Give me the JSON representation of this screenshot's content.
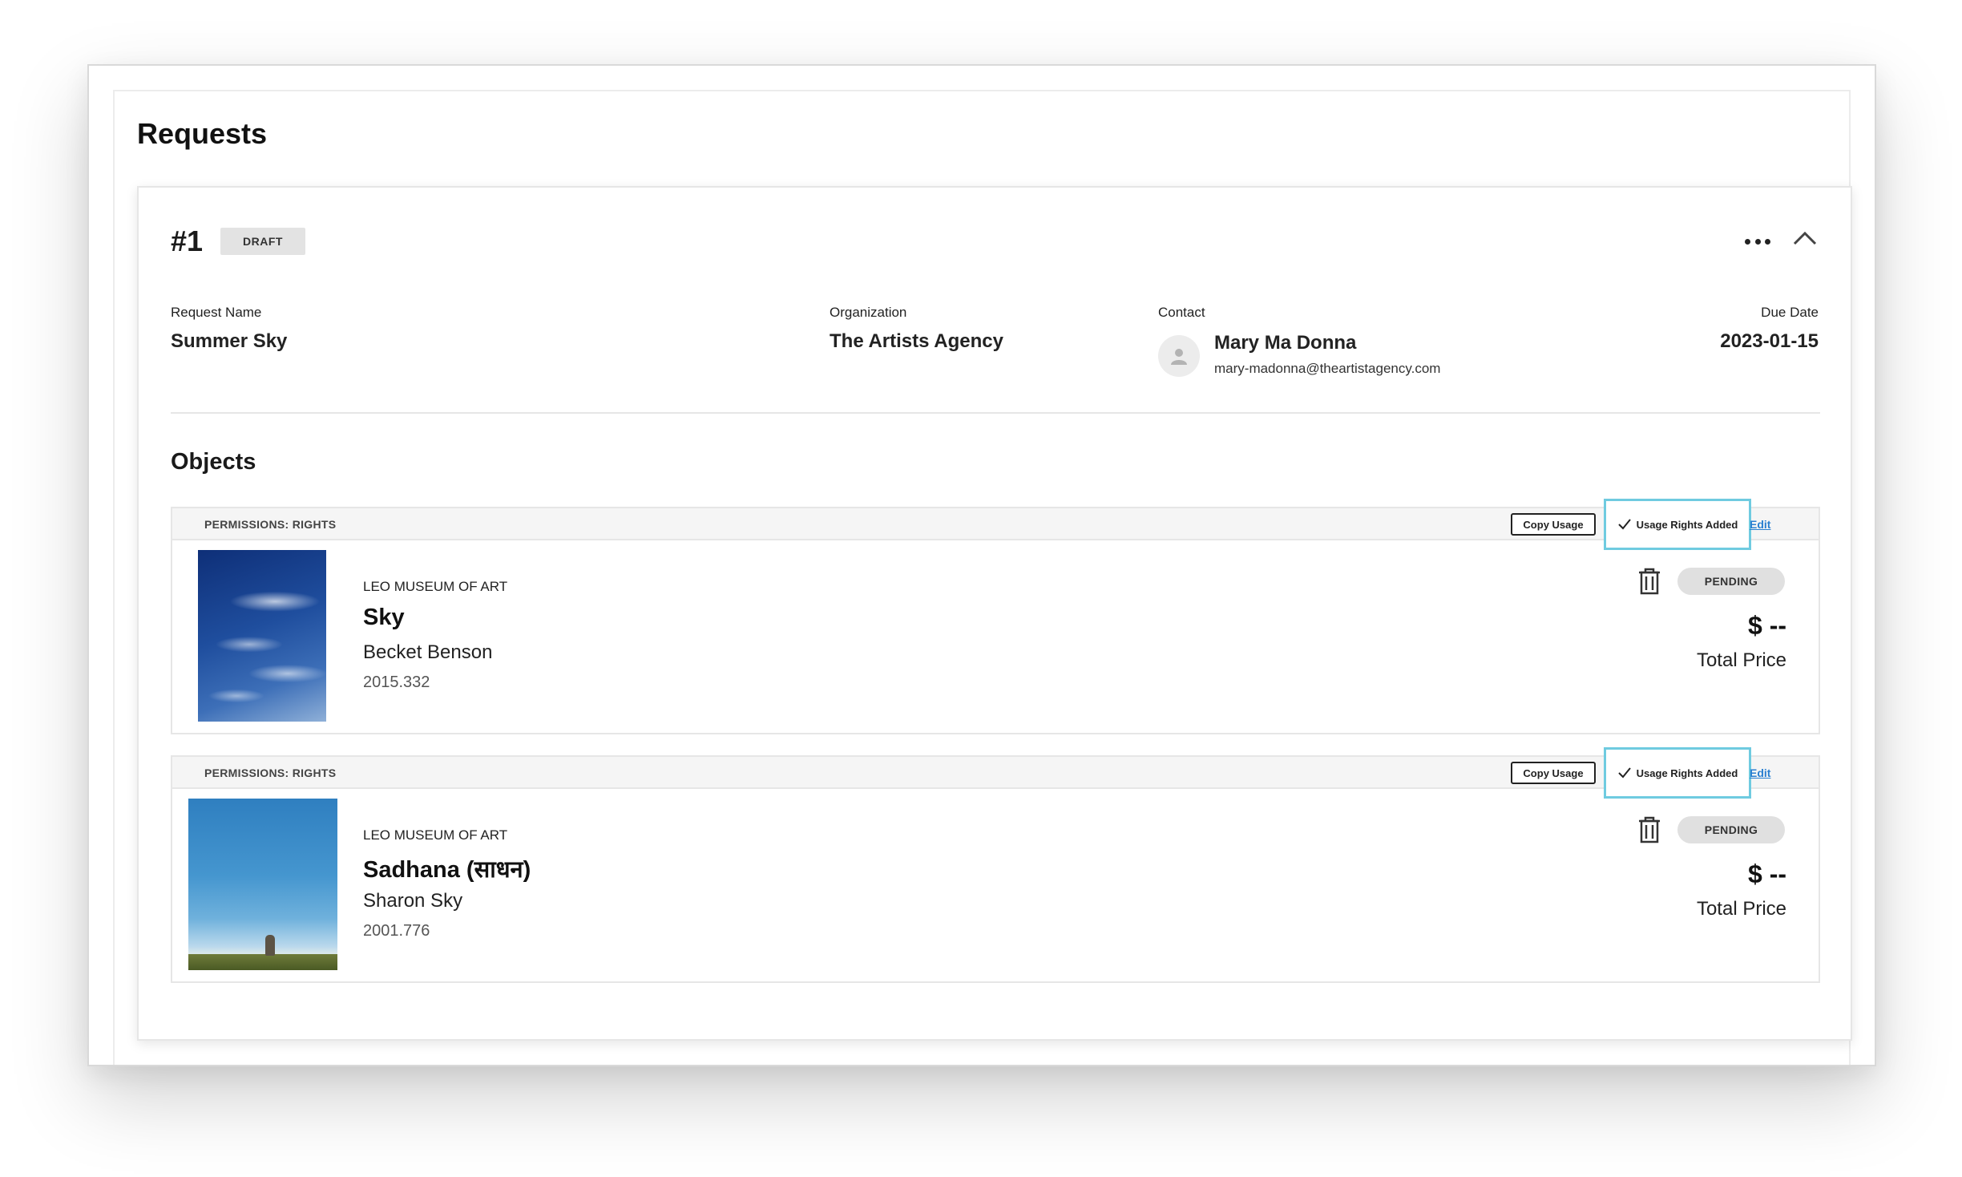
{
  "page": {
    "title": "Requests"
  },
  "request": {
    "number": "#1",
    "status": "DRAFT",
    "fields": {
      "request_name_label": "Request Name",
      "request_name": "Summer Sky",
      "organization_label": "Organization",
      "organization": "The Artists Agency",
      "contact_label": "Contact",
      "contact_name": "Mary Ma Donna",
      "contact_email": "mary-madonna@theartistagency.com",
      "due_date_label": "Due Date",
      "due_date": "2023-01-15"
    }
  },
  "objects": {
    "title": "Objects",
    "items": [
      {
        "permissions": "PERMISSIONS: RIGHTS",
        "copy_usage_label": "Copy Usage",
        "usage_added_label": "Usage Rights Added",
        "edit_label": "Edit",
        "museum": "LEO MUSEUM OF ART",
        "title": "Sky",
        "artist": "Becket Benson",
        "accession": "2015.332",
        "status": "PENDING",
        "price": "$ --",
        "price_label": "Total Price"
      },
      {
        "permissions": "PERMISSIONS: RIGHTS",
        "copy_usage_label": "Copy Usage",
        "usage_added_label": "Usage Rights Added",
        "edit_label": "Edit",
        "museum": "LEO MUSEUM OF ART",
        "title": "Sadhana (साधन)",
        "artist": "Sharon Sky",
        "accession": "2001.776",
        "status": "PENDING",
        "price": "$ --",
        "price_label": "Total Price"
      }
    ]
  },
  "icons": {
    "more": "more-horizontal-icon",
    "collapse": "chevron-up-icon",
    "avatar": "user-icon",
    "check": "check-icon",
    "delete": "trash-icon"
  },
  "colors": {
    "highlight_border": "#6fcbe0",
    "link": "#2a7fd0",
    "badge_bg": "#e0e0e0"
  }
}
